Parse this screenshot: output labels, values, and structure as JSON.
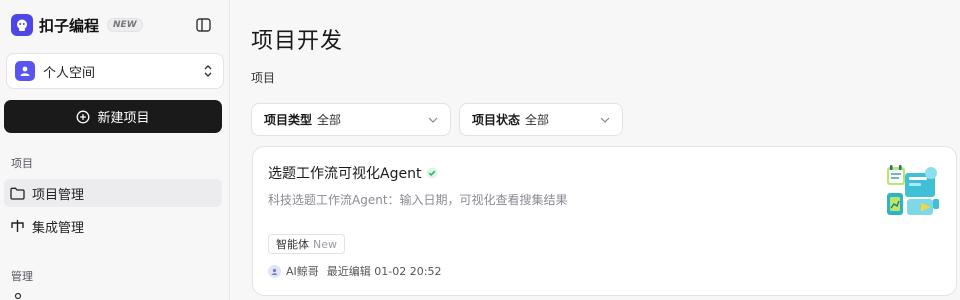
{
  "brand": {
    "name": "扣子编程",
    "badge": "NEW"
  },
  "workspace": {
    "label": "个人空间"
  },
  "sidebar": {
    "new_project_label": "新建项目",
    "section_project": "项目",
    "items": [
      {
        "label": "项目管理",
        "icon": "folder-icon"
      },
      {
        "label": "集成管理",
        "icon": "integration-icon"
      }
    ],
    "section_manage": "管理"
  },
  "main": {
    "title": "项目开发",
    "subtitle": "项目",
    "filters": [
      {
        "key": "项目类型",
        "value": "全部"
      },
      {
        "key": "项目状态",
        "value": "全部"
      }
    ]
  },
  "card": {
    "title": "选题工作流可视化Agent",
    "description": "科技选题工作流Agent：输入日期，可视化查看搜集结果",
    "tag": "智能体",
    "tag_new": "New",
    "author": "AI鲸哥",
    "edited": "最近编辑 01-02 20:52"
  },
  "colors": {
    "accent": "#4e47e8",
    "verified": "#22b35e",
    "dark_button": "#1a1a1a"
  }
}
